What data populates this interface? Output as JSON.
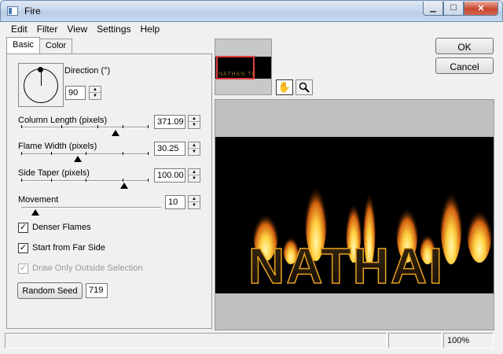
{
  "window": {
    "title": "Fire"
  },
  "menu": [
    "Edit",
    "Filter",
    "View",
    "Settings",
    "Help"
  ],
  "tabs": {
    "basic": "Basic",
    "color": "Color"
  },
  "direction": {
    "label": "Direction (°)",
    "value": "90"
  },
  "sliders": {
    "column_length": {
      "label": "Column Length (pixels)",
      "value": "371.09",
      "level": 0.62
    },
    "flame_width": {
      "label": "Flame Width (pixels)",
      "value": "30.25",
      "level": 0.42
    },
    "side_taper": {
      "label": "Side Taper (pixels)",
      "value": "100.00",
      "level": 0.78
    },
    "movement": {
      "label": "Movement",
      "value": "10",
      "level": 0.12
    }
  },
  "checkboxes": {
    "denser_flames": {
      "label": "Denser Flames",
      "checked": true
    },
    "start_far_side": {
      "label": "Start from Far Side",
      "checked": true
    },
    "draw_outside": {
      "label": "Draw Only Outside Selection",
      "checked": true,
      "disabled": true
    }
  },
  "seed": {
    "button": "Random Seed",
    "value": "719"
  },
  "buttons": {
    "ok": "OK",
    "cancel": "Cancel"
  },
  "preview": {
    "text": "NATHAI",
    "nav_text": "NATHAN TE"
  },
  "status": {
    "zoom": "100%"
  },
  "colors": {
    "fire_core": "#ffe060",
    "fire_edge": "#c05000",
    "nav_rect": "#e04040"
  }
}
